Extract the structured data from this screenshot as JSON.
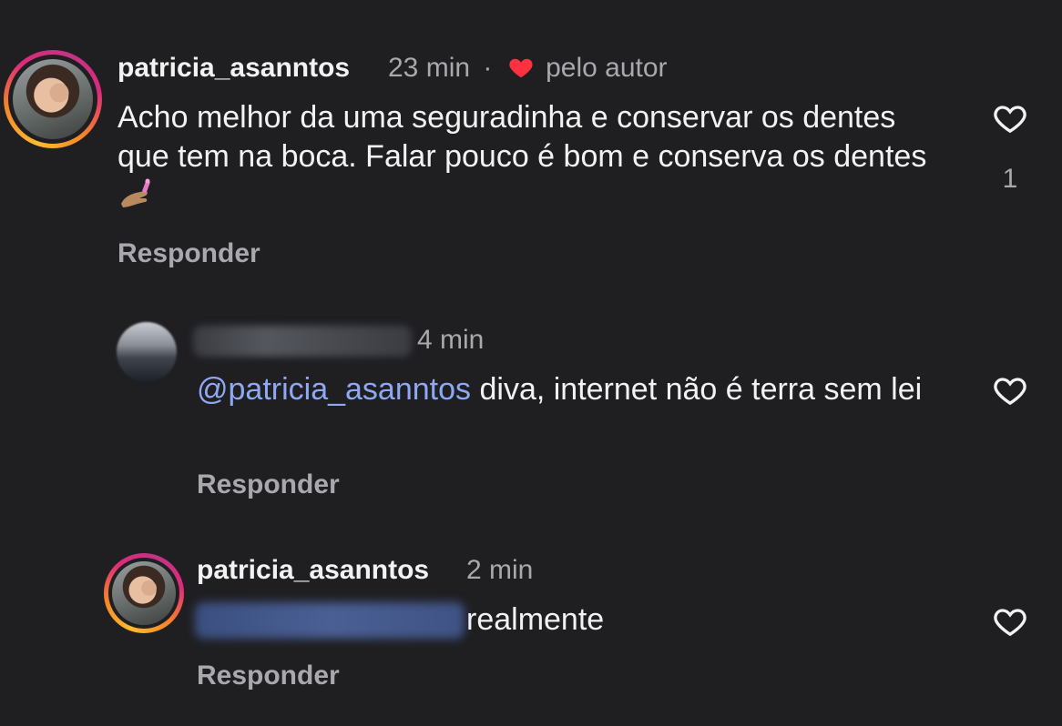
{
  "comments": [
    {
      "username": "patricia_asanntos",
      "time": "23 min",
      "separator": "·",
      "liked_by_author_label": "pelo autor",
      "text": "Acho melhor da uma seguradinha e conservar os dentes que tem na boca. Falar pouco é bom e conserva os dentes",
      "emoji_icon": "nail-polish-emoji",
      "like_icon": "heart-outline-icon",
      "like_count": "1",
      "reply_label": "Responder"
    },
    {
      "username_blurred": true,
      "time": "4 min",
      "mention": "@patricia_asanntos",
      "text": " diva, internet não é terra sem lei",
      "like_icon": "heart-outline-icon",
      "reply_label": "Responder"
    },
    {
      "username": "patricia_asanntos",
      "time": "2 min",
      "mention_blurred": true,
      "text": "realmente",
      "like_icon": "heart-outline-icon",
      "reply_label": "Responder"
    }
  ],
  "colors": {
    "background": "#1f1f22",
    "text": "#f2f2f2",
    "muted": "#a8a8ad",
    "mention": "#8fa8f2",
    "author_heart": "#ff3040"
  }
}
